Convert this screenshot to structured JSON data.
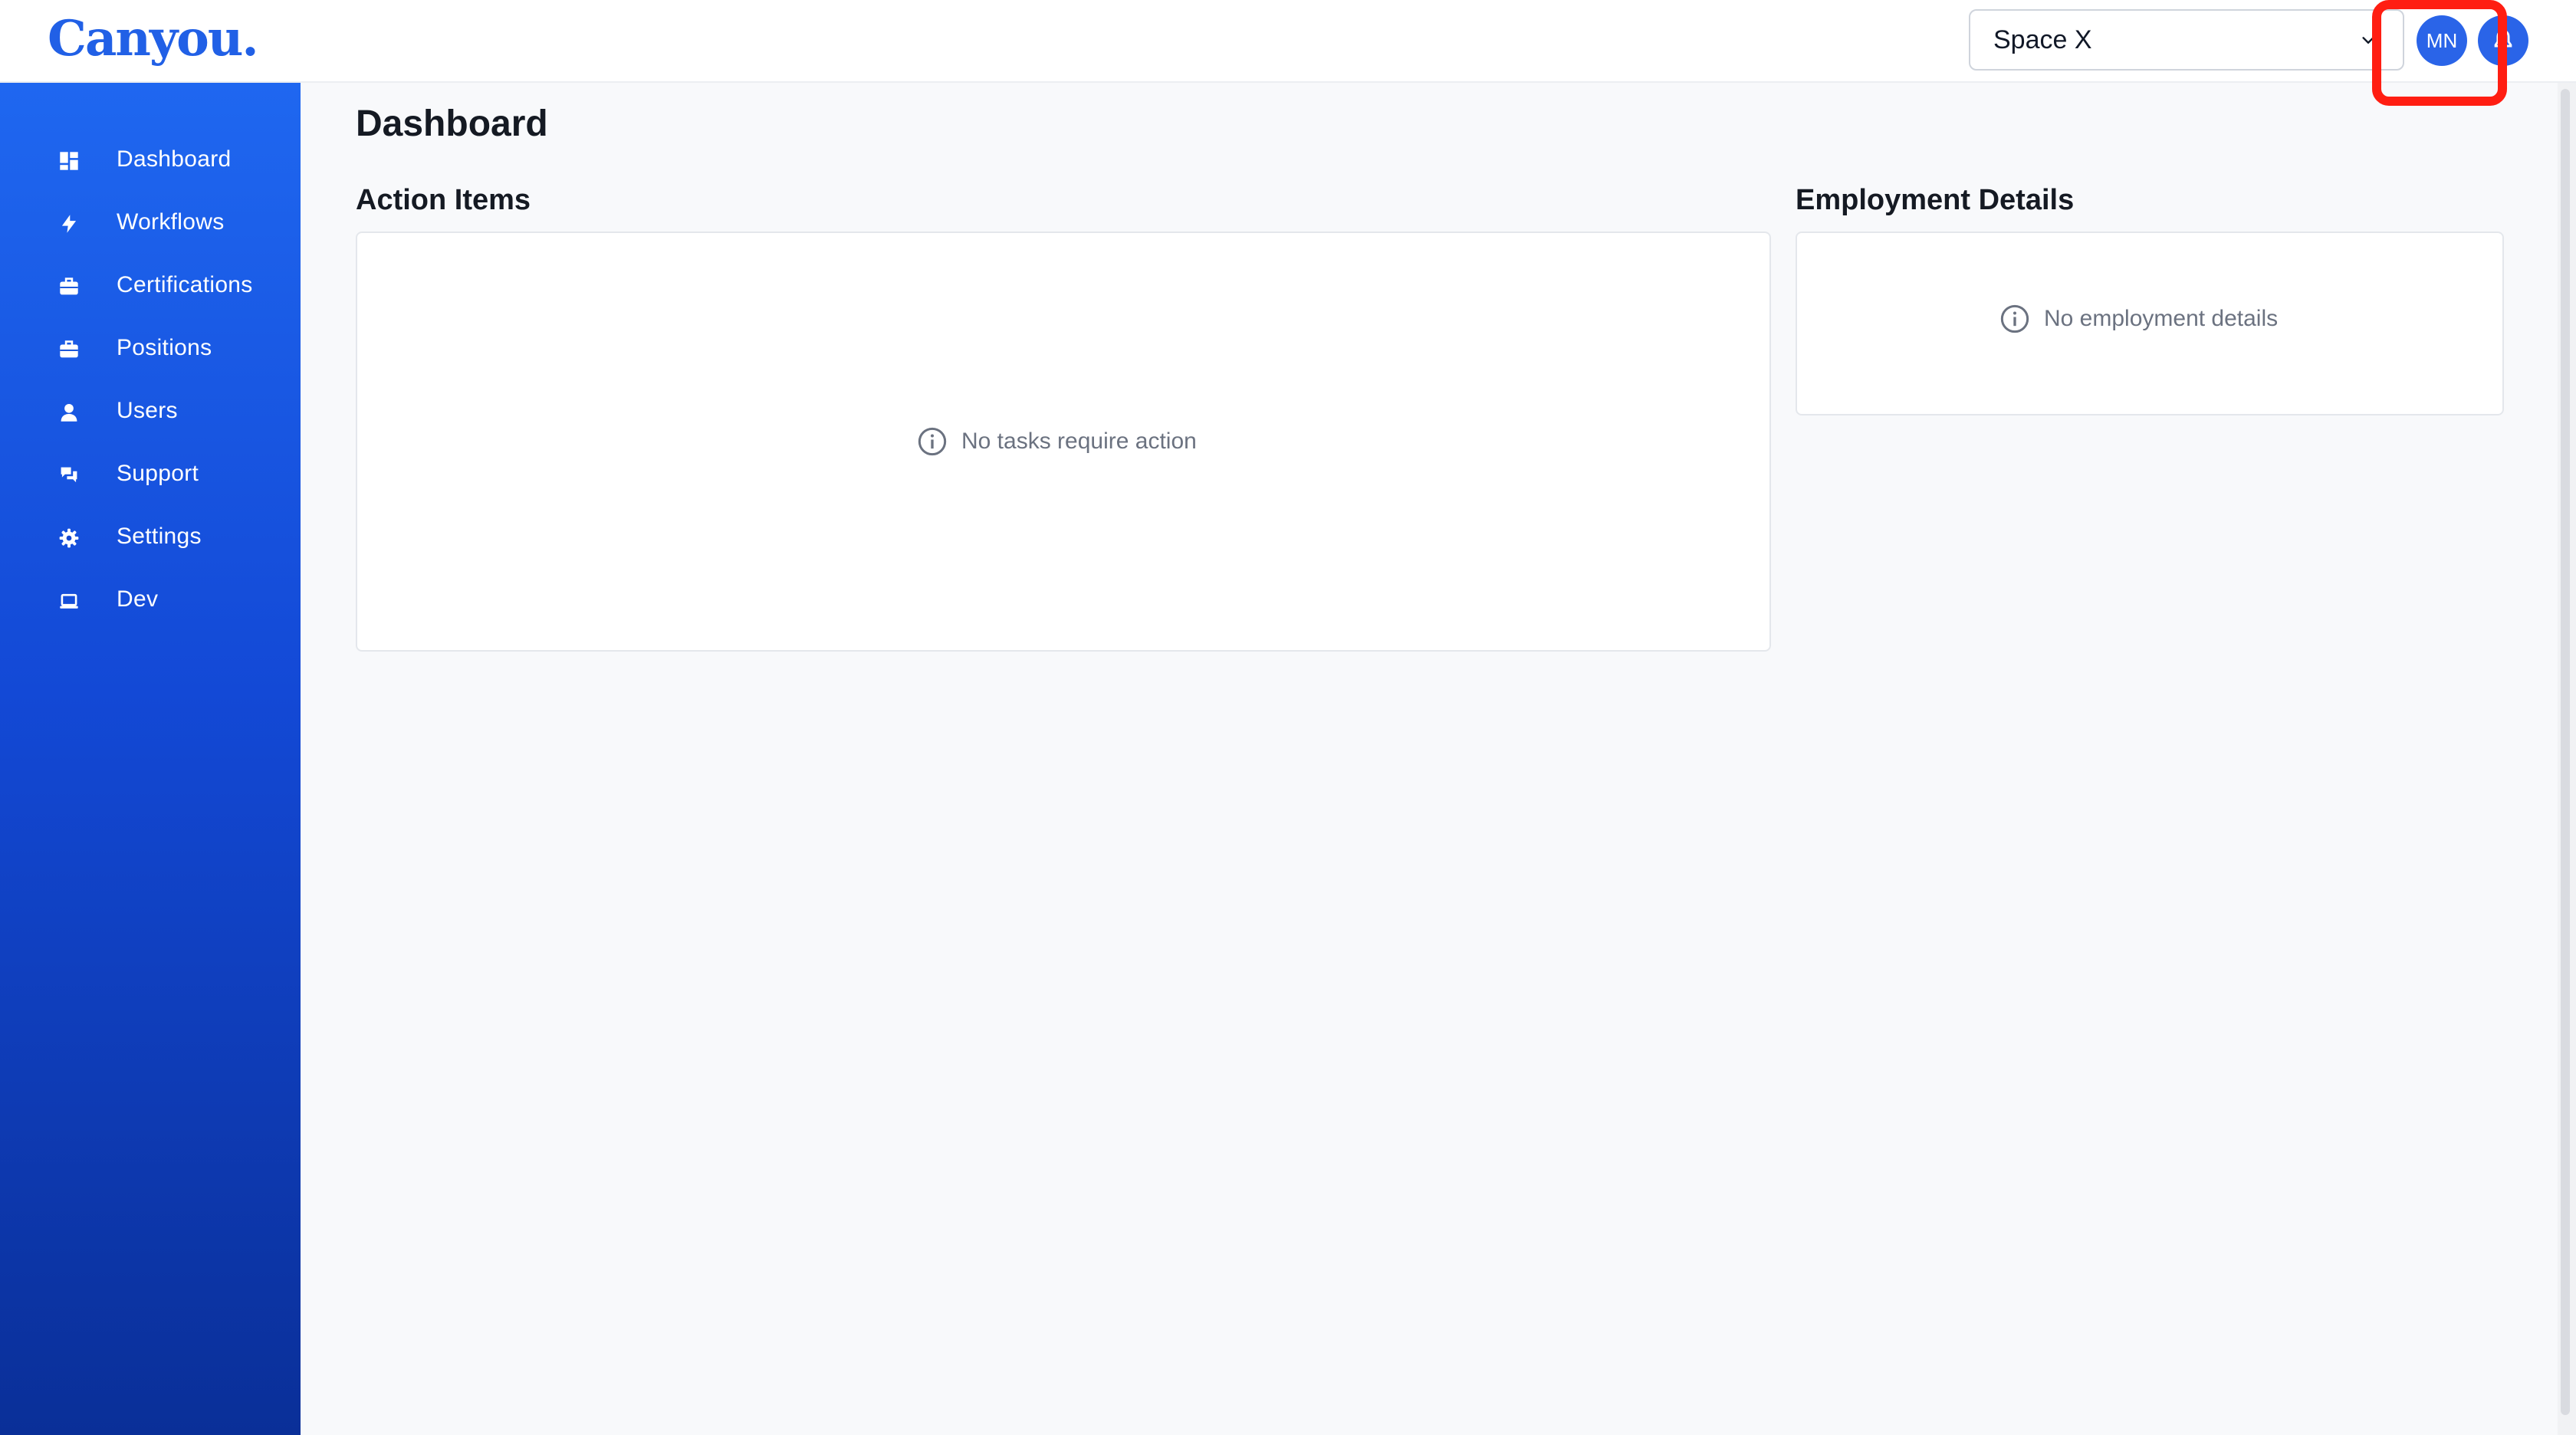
{
  "header": {
    "logo": "Canyou.",
    "workspace": {
      "selected": "Space X"
    },
    "avatar_initials": "MN"
  },
  "sidebar": {
    "items": [
      {
        "label": "Dashboard",
        "icon": "dashboard-grid-icon"
      },
      {
        "label": "Workflows",
        "icon": "lightning-bolt-icon"
      },
      {
        "label": "Certifications",
        "icon": "briefcase-icon"
      },
      {
        "label": "Positions",
        "icon": "briefcase-icon"
      },
      {
        "label": "Users",
        "icon": "user-icon"
      },
      {
        "label": "Support",
        "icon": "chat-bubbles-icon"
      },
      {
        "label": "Settings",
        "icon": "gear-icon"
      },
      {
        "label": "Dev",
        "icon": "laptop-icon"
      }
    ]
  },
  "main": {
    "title": "Dashboard",
    "action_items": {
      "title": "Action Items",
      "empty_message": "No tasks require action"
    },
    "employment_details": {
      "title": "Employment Details",
      "empty_message": "No employment details"
    }
  },
  "colors": {
    "brand": "#2160e6",
    "sidebar_top": "#1f67f0",
    "sidebar_bottom": "#0a2f98",
    "highlight": "#ff1e12"
  }
}
